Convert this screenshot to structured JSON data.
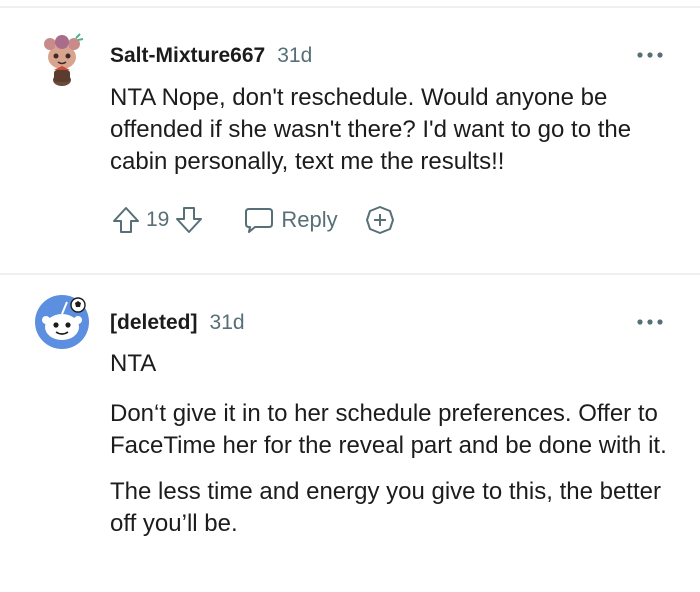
{
  "comments": [
    {
      "username": "Salt-Mixture667",
      "time": "31d",
      "avatar_icon": "snoo-avatar-flower-icon",
      "paragraphs": [
        "NTA Nope, don't reschedule. Would anyone be offended if she wasn't there? I'd want to go to the cabin personally, text me the results!!"
      ],
      "score": "19",
      "reply_label": "Reply"
    },
    {
      "username": "[deleted]",
      "time": "31d",
      "avatar_icon": "snoo-avatar-default-icon",
      "paragraphs": [
        "NTA",
        "Don‘t give it in to her schedule preferences. Offer to FaceTime her for the reveal part and be done with it.",
        "The less time and energy you give to this, the better off you’ll be."
      ]
    }
  ],
  "colors": {
    "text": "#1c1c1c",
    "meta": "#576f76",
    "divider": "#edeff1",
    "avatar_blue": "#5c8fe0"
  },
  "icons": [
    "more-options-icon",
    "upvote-icon",
    "downvote-icon",
    "reply-bubble-icon",
    "add-award-icon"
  ]
}
